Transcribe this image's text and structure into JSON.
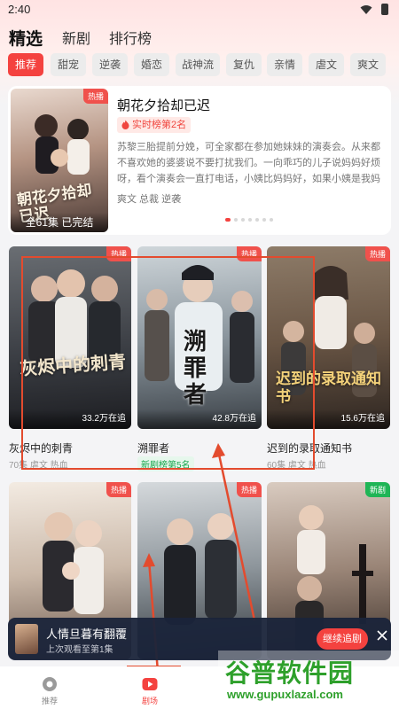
{
  "status_bar": {
    "time": "2:40"
  },
  "main_tabs": [
    {
      "label": "精选",
      "active": true
    },
    {
      "label": "新剧",
      "active": false
    },
    {
      "label": "排行榜",
      "active": false
    }
  ],
  "genres": [
    {
      "label": "推荐",
      "active": true
    },
    {
      "label": "甜宠"
    },
    {
      "label": "逆袭"
    },
    {
      "label": "婚恋"
    },
    {
      "label": "战神流"
    },
    {
      "label": "复仇"
    },
    {
      "label": "亲情"
    },
    {
      "label": "虐文"
    },
    {
      "label": "爽文"
    }
  ],
  "featured": {
    "badge": "热播",
    "title": "朝花夕拾却已迟",
    "rank_tag": "实时榜第2名",
    "description": "苏黎三胎提前分娩，可全家都在参加她妹妹的演奏会。从来都不喜欢她的婆婆说不要打扰我们。一向乖巧的儿子说妈妈好烦呀，看个演奏会一直打电话，小姨比妈妈好，如果小姨是我妈妈就好了。老…",
    "tags": "爽文 总裁 逆袭",
    "poster_text": "朝花夕拾却已迟",
    "episodes": "全61集 已完结",
    "carousel_total": 7,
    "carousel_active": 0
  },
  "dramas": [
    {
      "title": "灰烬中的刺青",
      "badge": "热播",
      "badge_type": "hot",
      "plays": "33.2万在追",
      "meta": "70集 虐文 热血",
      "poster_text": "灰烬中的刺青"
    },
    {
      "title": "溯罪者",
      "badge": "热播",
      "badge_type": "hot",
      "plays": "42.8万在追",
      "rank": "新剧榜第5名",
      "poster_text": "溯罪者"
    },
    {
      "title": "迟到的录取通知书",
      "badge": "热播",
      "badge_type": "hot",
      "plays": "15.6万在追",
      "meta": "60集 虐文 热血",
      "poster_text": "迟到的录取通知书"
    },
    {
      "title": "",
      "badge": "热播",
      "badge_type": "hot",
      "poster_text": ""
    },
    {
      "title": "",
      "badge": "热播",
      "badge_type": "hot",
      "poster_text": ""
    },
    {
      "title": "",
      "badge": "新剧",
      "badge_type": "new",
      "poster_text": ""
    }
  ],
  "continue_watching": {
    "title": "人情旦暮有翻覆",
    "subtitle": "上次观看至第1集",
    "button": "继续追剧"
  },
  "bottom_nav": [
    {
      "label": "推荐",
      "icon": "recommend-icon",
      "active": false
    },
    {
      "label": "剧场",
      "icon": "theater-play-icon",
      "active": true
    }
  ],
  "watermark": {
    "main": "谷普软件园",
    "sub": "www.gupuxlazal.com"
  },
  "colors": {
    "accent": "#f4423f",
    "new_badge": "#1fb556",
    "annotation": "#e34b2e"
  }
}
